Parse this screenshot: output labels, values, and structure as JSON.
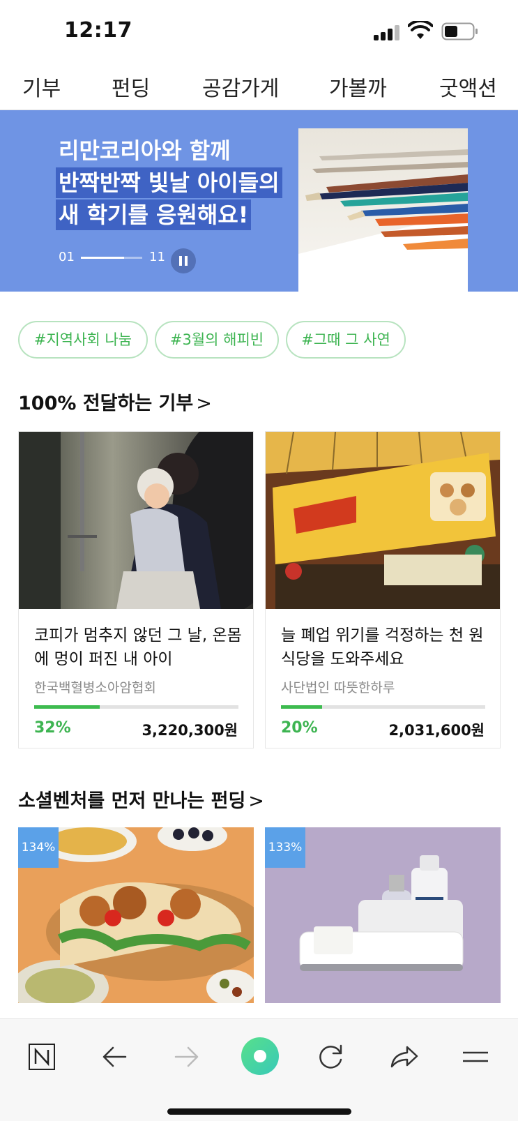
{
  "status_bar": {
    "time": "12:17",
    "icons": [
      "signal-icon",
      "wifi-icon",
      "battery-icon"
    ]
  },
  "top_nav": {
    "items": [
      "기부",
      "펀딩",
      "공감가게",
      "가볼까",
      "굿액션"
    ]
  },
  "banner": {
    "line1": "리만코리아와 함께",
    "line2": "반짝반짝 빛날 아이들의",
    "line3": "새 학기를 응원해요!",
    "current_page": "01",
    "total_pages": "11",
    "progress": 0.7,
    "image": "colored-pencils-photo",
    "bg_color": "#6f94e4",
    "highlight_color": "#3f63c4"
  },
  "tags": [
    "#지역사회 나눔",
    "#3월의 해피빈",
    "#그때 그 사연"
  ],
  "donation_section": {
    "title": "100% 전달하는 기부",
    "chevron": ">",
    "cards": [
      {
        "image": "child-hospital-photo",
        "title": "코피가 멈추지 않던 그 날, 온몸에 멍이 퍼진 내 아이",
        "org": "한국백혈병소아암협회",
        "percent_label": "32%",
        "progress": 0.32,
        "amount": "3,220,300원"
      },
      {
        "image": "restaurant-sign-photo",
        "title": "늘 폐업 위기를 걱정하는 천 원 식당을 도와주세요",
        "org": "사단법인 따뜻한하루",
        "percent_label": "20%",
        "progress": 0.2,
        "amount": "2,031,600원"
      }
    ]
  },
  "funding_section": {
    "title": "소셜벤처를 먼저 만나는 펀딩",
    "chevron": ">",
    "cards": [
      {
        "image": "pita-sandwich-photo",
        "badge": "134%"
      },
      {
        "image": "skincare-products-photo",
        "badge": "133%"
      }
    ]
  },
  "toolbar": {
    "buttons": [
      "naver-home-icon",
      "back-arrow-icon",
      "forward-arrow-icon",
      "green-dot-icon",
      "refresh-icon",
      "share-icon",
      "menu-icon"
    ],
    "accent_color": "#3dd39a"
  },
  "colors": {
    "green": "#3db451",
    "badge_blue": "#5ba1e8"
  }
}
